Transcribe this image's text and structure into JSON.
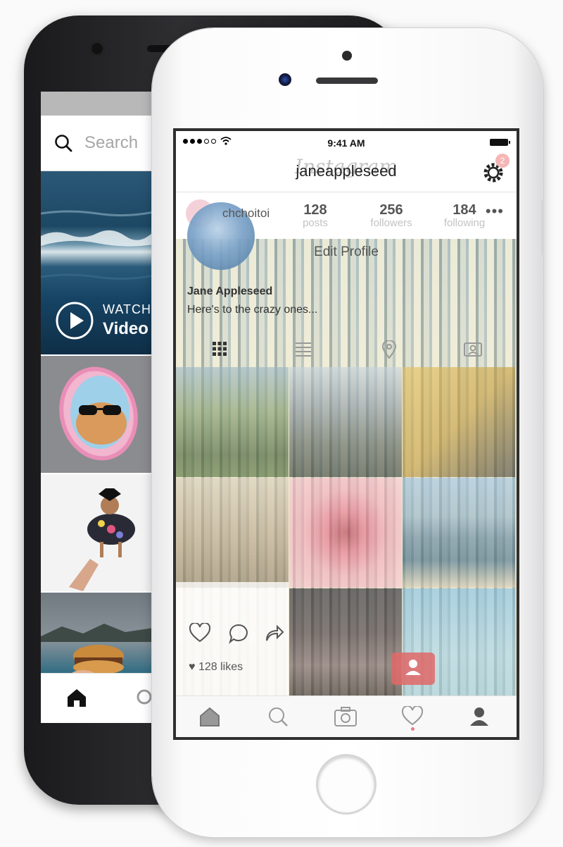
{
  "back_phone": {
    "search": {
      "placeholder": "Search"
    },
    "video": {
      "eyebrow": "WATCH",
      "label": "Video"
    },
    "tabs": [
      "home-icon",
      "search-icon"
    ]
  },
  "front_phone": {
    "status_bar": {
      "time": "9:41 AM"
    },
    "nav": {
      "title": "janeappleseed",
      "logo_text": "Instagram",
      "notification_count": "2"
    },
    "profile": {
      "handle": "chchoitoi",
      "stats": [
        {
          "value": "128",
          "label": "posts"
        },
        {
          "value": "256",
          "label": "followers"
        },
        {
          "value": "184",
          "label": "following"
        }
      ],
      "more": "•••",
      "edit_button": "Edit Profile",
      "name": "Jane Appleseed",
      "bio": "Here's to the crazy ones..."
    },
    "view_tabs": [
      "grid-icon",
      "list-icon",
      "location-icon",
      "tagged-icon"
    ],
    "post": {
      "likes": "128 likes"
    },
    "tab_bar": [
      "home-icon",
      "search-icon",
      "camera-icon",
      "heart-icon",
      "profile-icon"
    ]
  },
  "colors": {
    "accent_badge": "#f5b6b6",
    "notification_dot": "#e87b86",
    "screen_border": "#2f2f2f"
  }
}
